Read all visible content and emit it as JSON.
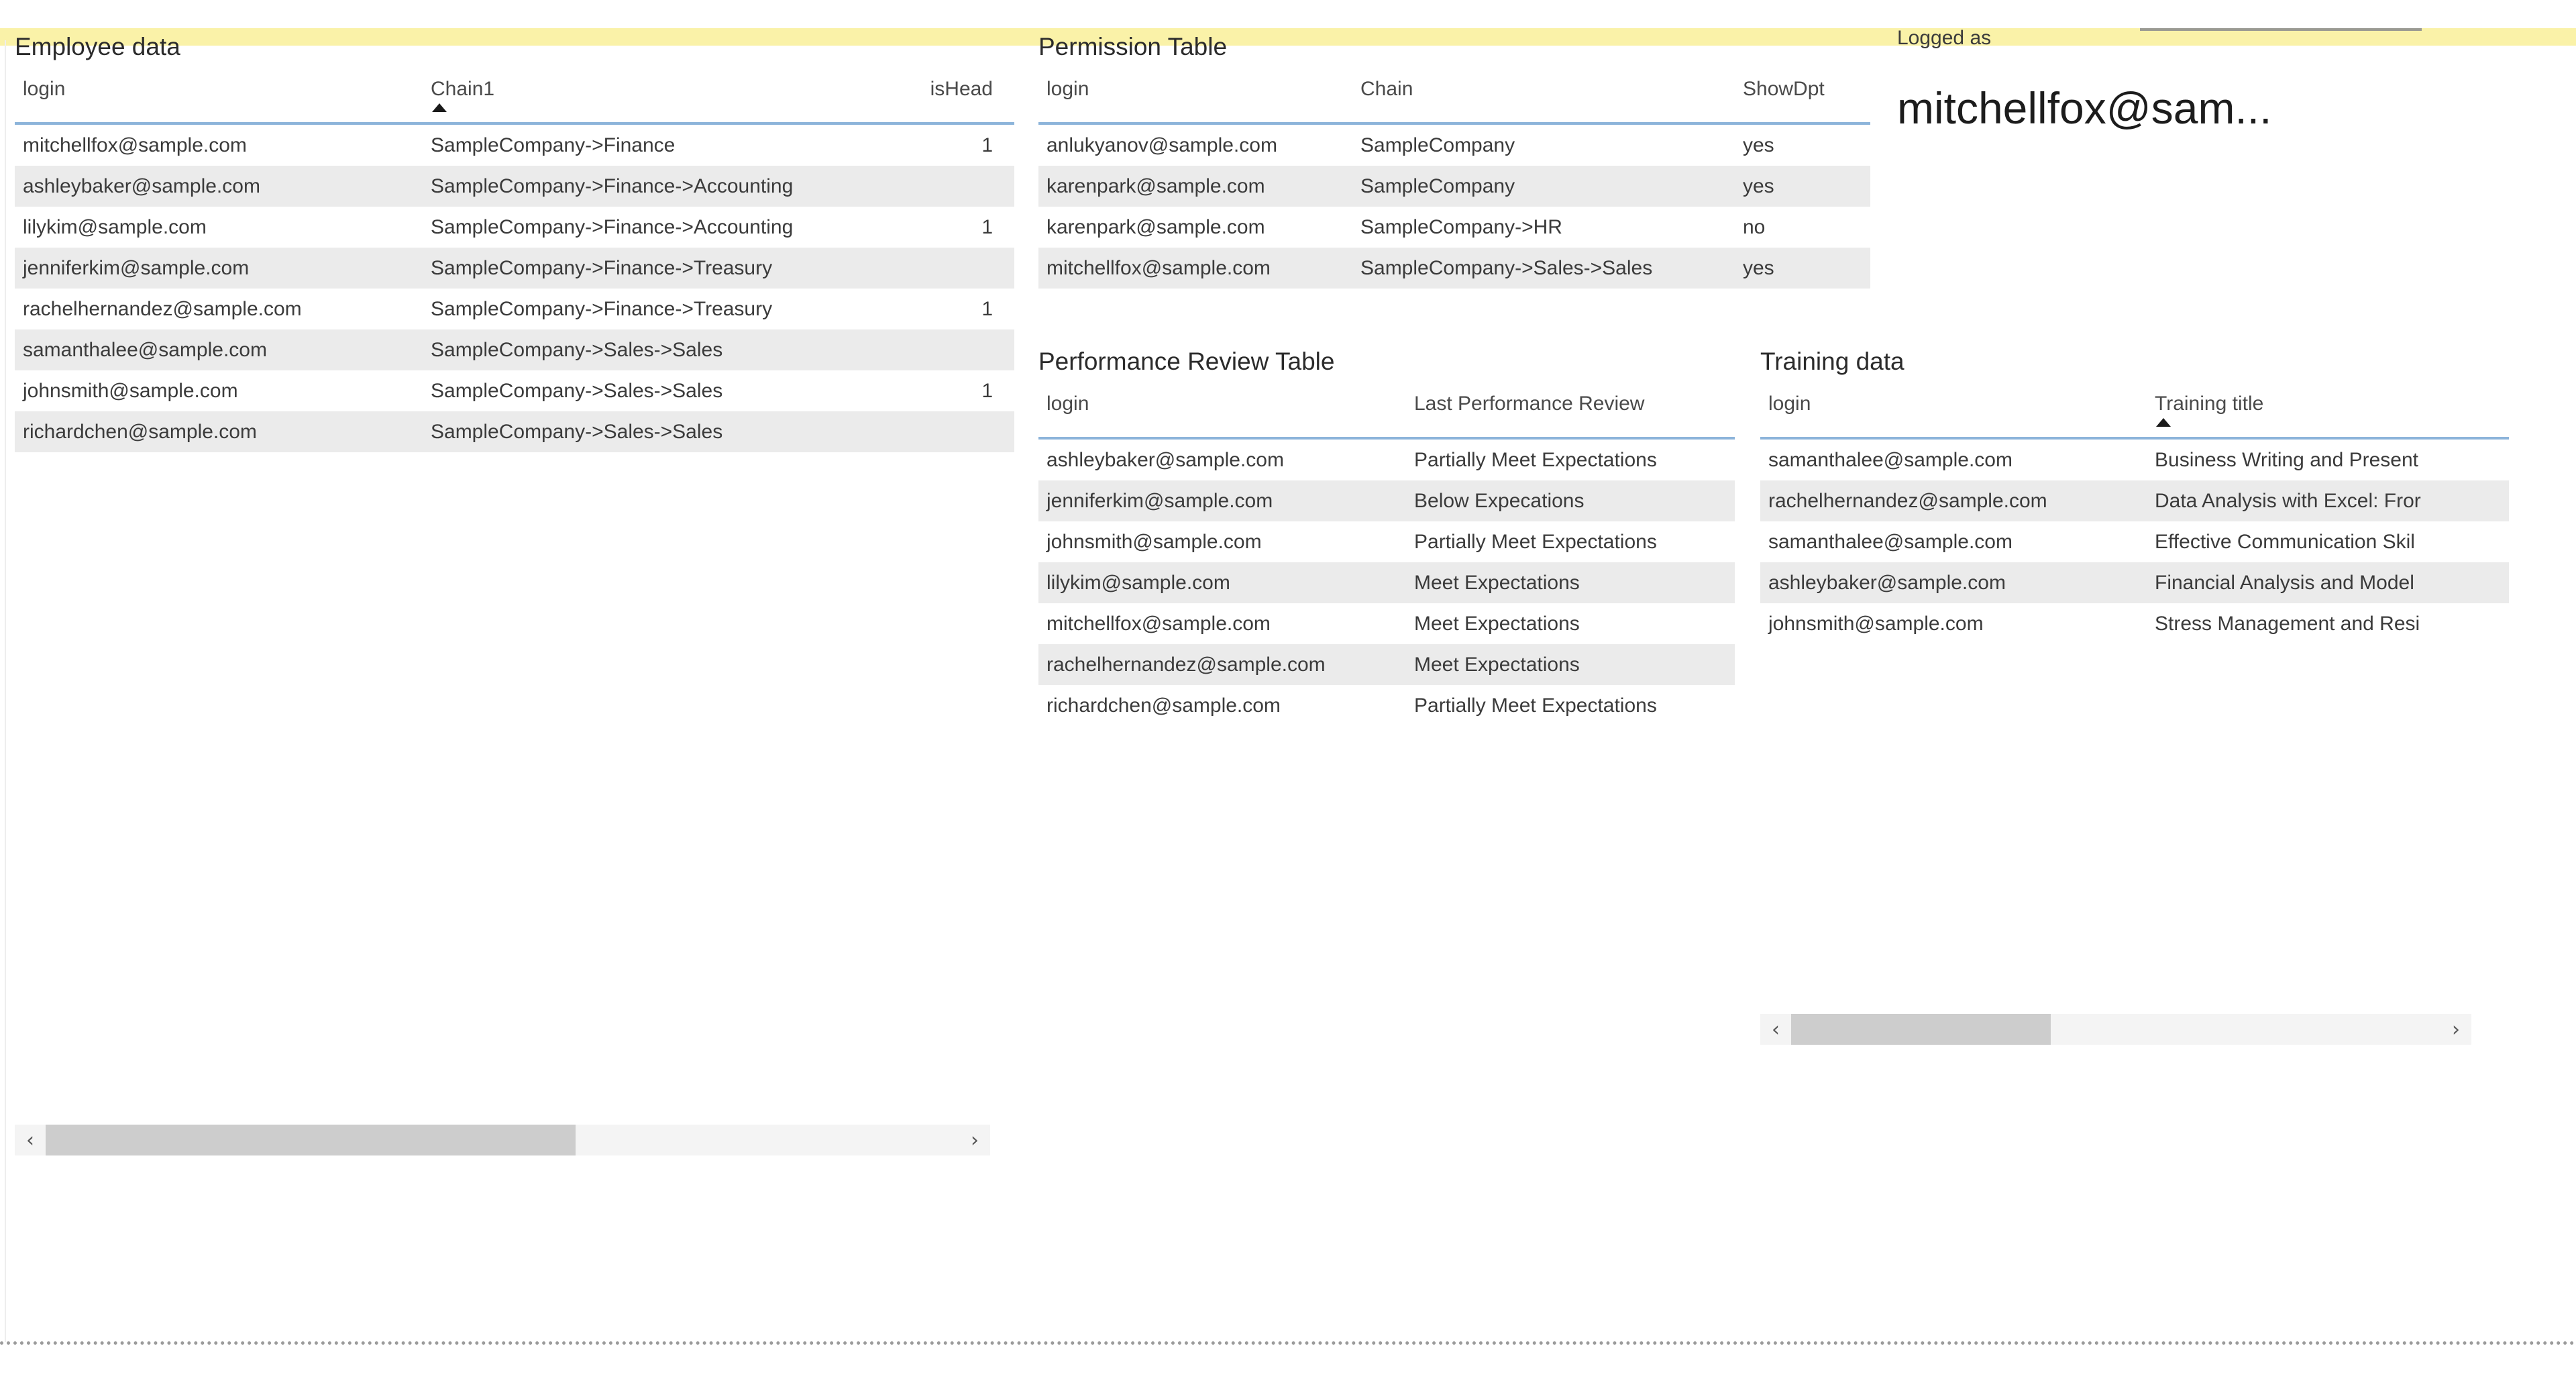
{
  "chrome": {
    "yellow_band_color": "#faf2a8",
    "accent_underline_color": "#8cb4da",
    "row_alt_color": "#ebebeb"
  },
  "employee": {
    "title": "Employee data",
    "columns": [
      "login",
      "Chain1",
      "isHead"
    ],
    "sorted_column": "Chain1",
    "sort_direction": "ascending",
    "rows": [
      {
        "login": "mitchellfox@sample.com",
        "chain": "SampleCompany->Finance",
        "ishead": "1"
      },
      {
        "login": "ashleybaker@sample.com",
        "chain": "SampleCompany->Finance->Accounting",
        "ishead": ""
      },
      {
        "login": "lilykim@sample.com",
        "chain": "SampleCompany->Finance->Accounting",
        "ishead": "1"
      },
      {
        "login": "jenniferkim@sample.com",
        "chain": "SampleCompany->Finance->Treasury",
        "ishead": ""
      },
      {
        "login": "rachelhernandez@sample.com",
        "chain": "SampleCompany->Finance->Treasury",
        "ishead": "1"
      },
      {
        "login": "samanthalee@sample.com",
        "chain": "SampleCompany->Sales->Sales",
        "ishead": ""
      },
      {
        "login": "johnsmith@sample.com",
        "chain": "SampleCompany->Sales->Sales",
        "ishead": "1"
      },
      {
        "login": "richardchen@sample.com",
        "chain": "SampleCompany->Sales->Sales",
        "ishead": ""
      }
    ],
    "scrollbar": {
      "left_arrow": "‹",
      "right_arrow": "›",
      "thumb_percent": 58
    }
  },
  "permission": {
    "title": "Permission Table",
    "columns": [
      "login",
      "Chain",
      "ShowDpt"
    ],
    "rows": [
      {
        "login": "anlukyanov@sample.com",
        "chain": "SampleCompany",
        "showdpt": "yes"
      },
      {
        "login": "karenpark@sample.com",
        "chain": "SampleCompany",
        "showdpt": "yes"
      },
      {
        "login": "karenpark@sample.com",
        "chain": "SampleCompany->HR",
        "showdpt": "no"
      },
      {
        "login": "mitchellfox@sample.com",
        "chain": "SampleCompany->Sales->Sales",
        "showdpt": "yes"
      }
    ]
  },
  "performance": {
    "title": "Performance Review Table",
    "columns": [
      "login",
      "Last Performance Review"
    ],
    "rows": [
      {
        "login": "ashleybaker@sample.com",
        "review": "Partially Meet Expectations"
      },
      {
        "login": "jenniferkim@sample.com",
        "review": "Below Expecations"
      },
      {
        "login": "johnsmith@sample.com",
        "review": "Partially Meet Expectations"
      },
      {
        "login": "lilykim@sample.com",
        "review": "Meet Expectations"
      },
      {
        "login": "mitchellfox@sample.com",
        "review": "Meet Expectations"
      },
      {
        "login": "rachelhernandez@sample.com",
        "review": "Meet Expectations"
      },
      {
        "login": "richardchen@sample.com",
        "review": "Partially Meet Expectations"
      }
    ]
  },
  "training": {
    "title": "Training data",
    "columns": [
      "login",
      "Training title"
    ],
    "sorted_column": "Training title",
    "sort_direction": "ascending",
    "rows": [
      {
        "login": "samanthalee@sample.com",
        "title": "Business Writing and Present"
      },
      {
        "login": "rachelhernandez@sample.com",
        "title": "Data Analysis with Excel: Fror"
      },
      {
        "login": "samanthalee@sample.com",
        "title": "Effective Communication Skil"
      },
      {
        "login": "ashleybaker@sample.com",
        "title": "Financial Analysis and Model"
      },
      {
        "login": "johnsmith@sample.com",
        "title": "Stress Management and Resi"
      }
    ],
    "scrollbar": {
      "left_arrow": "‹",
      "right_arrow": "›",
      "thumb_percent": 40
    }
  },
  "logged": {
    "label": "Logged as",
    "user": "mitchellfox@sam..."
  }
}
